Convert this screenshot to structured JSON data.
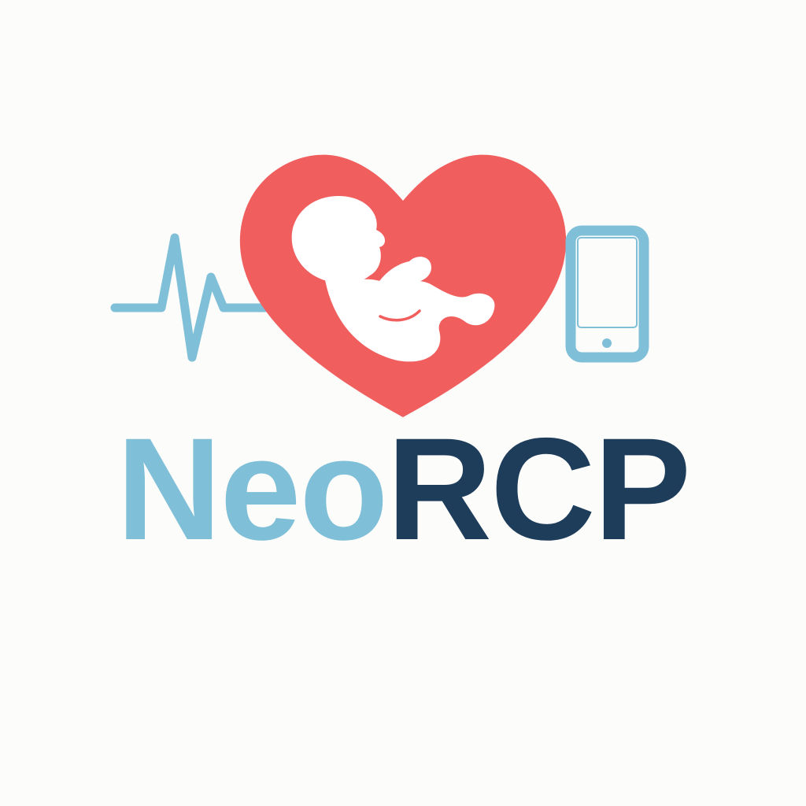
{
  "brand": {
    "name_part_1": "Neo",
    "name_part_2": "RCP"
  },
  "icons": {
    "heartbeat": "heartbeat-line-icon",
    "heart": "heart-icon",
    "baby": "baby-silhouette-icon",
    "phone": "smartphone-icon"
  },
  "colors": {
    "heart_red": "#f15e5e",
    "light_blue": "#7fbfd8",
    "navy": "#1d3d5a",
    "background": "#fcfcfb",
    "baby_white": "#ffffff"
  }
}
